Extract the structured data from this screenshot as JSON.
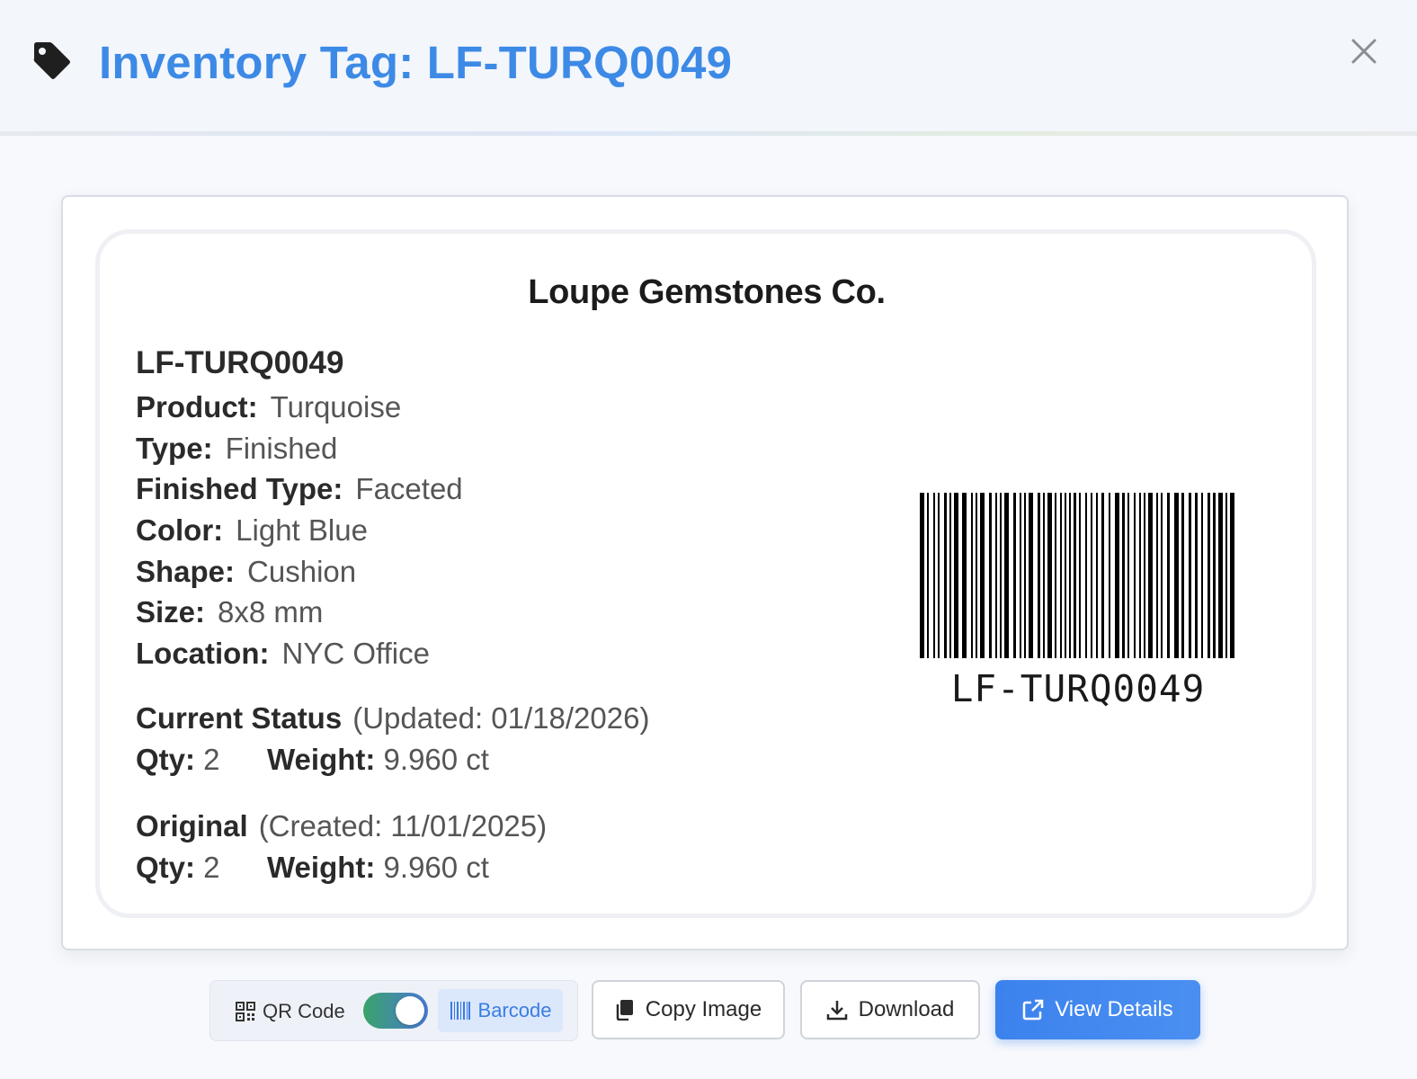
{
  "header": {
    "title": "Inventory Tag: LF-TURQ0049",
    "title_color": "#3d8ae6",
    "icon": "tag-icon",
    "close_icon": "close-icon"
  },
  "label": {
    "company": "Loupe Gemstones Co.",
    "sku": "LF-TURQ0049",
    "fields": [
      {
        "key": "Product:",
        "value": "Turquoise"
      },
      {
        "key": "Type:",
        "value": "Finished"
      },
      {
        "key": "Finished Type:",
        "value": "Faceted"
      },
      {
        "key": "Color:",
        "value": "Light Blue"
      },
      {
        "key": "Shape:",
        "value": "Cushion"
      },
      {
        "key": "Size:",
        "value": "8x8 mm"
      },
      {
        "key": "Location:",
        "value": "NYC Office"
      }
    ],
    "current_status": {
      "title": "Current Status",
      "updated": "(Updated: 01/18/2026)",
      "qty_label": "Qty:",
      "qty": "2",
      "weight_label": "Weight:",
      "weight": "9.960 ct"
    },
    "original": {
      "title": "Original",
      "created": "(Created: 11/01/2025)",
      "qty_label": "Qty:",
      "qty": "2",
      "weight_label": "Weight:",
      "weight": "9.960 ct"
    },
    "barcode_text": "LF-TURQ0049"
  },
  "toolbar": {
    "qr_label": "QR Code",
    "barcode_label": "Barcode",
    "toggle_on": true,
    "copy_label": "Copy Image",
    "download_label": "Download",
    "view_label": "View Details",
    "accent": "#3c82ee"
  }
}
